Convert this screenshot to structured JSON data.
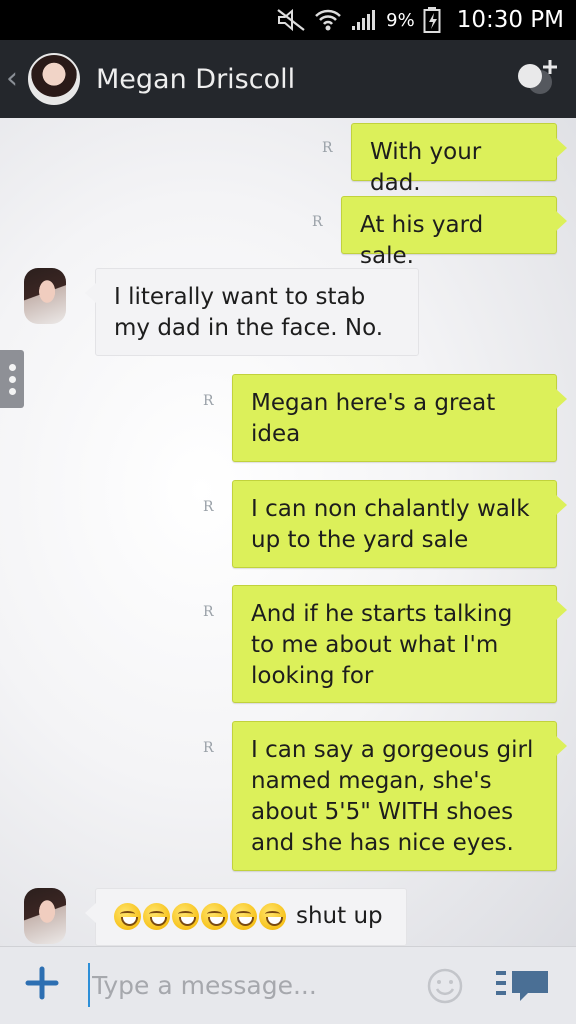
{
  "status_bar": {
    "battery_percent": "9%",
    "time": "10:30 PM"
  },
  "header": {
    "contact_name": "Megan Driscoll"
  },
  "messages": [
    {
      "direction": "out",
      "text": "With your dad."
    },
    {
      "direction": "out",
      "text": "At his yard sale."
    },
    {
      "direction": "in",
      "text": "I literally want to stab my dad in the face. No."
    },
    {
      "direction": "out",
      "text": "Megan here's a great idea"
    },
    {
      "direction": "out",
      "text": "I can non chalantly walk up to the yard sale"
    },
    {
      "direction": "out",
      "text": "And if he starts talking to me about what I'm looking for"
    },
    {
      "direction": "out",
      "text": "I can say a gorgeous girl named megan, she's about 5'5\" WITH shoes and she has nice eyes."
    },
    {
      "direction": "in",
      "text": "shut up",
      "emoji_count": 6
    }
  ],
  "read_marker": "R",
  "composer": {
    "placeholder": "Type a message..."
  },
  "colors": {
    "outgoing_bubble": "#dcf05a",
    "incoming_bubble": "#f3f3f5",
    "header_bg": "#24272c",
    "accent": "#2d6fb2"
  }
}
